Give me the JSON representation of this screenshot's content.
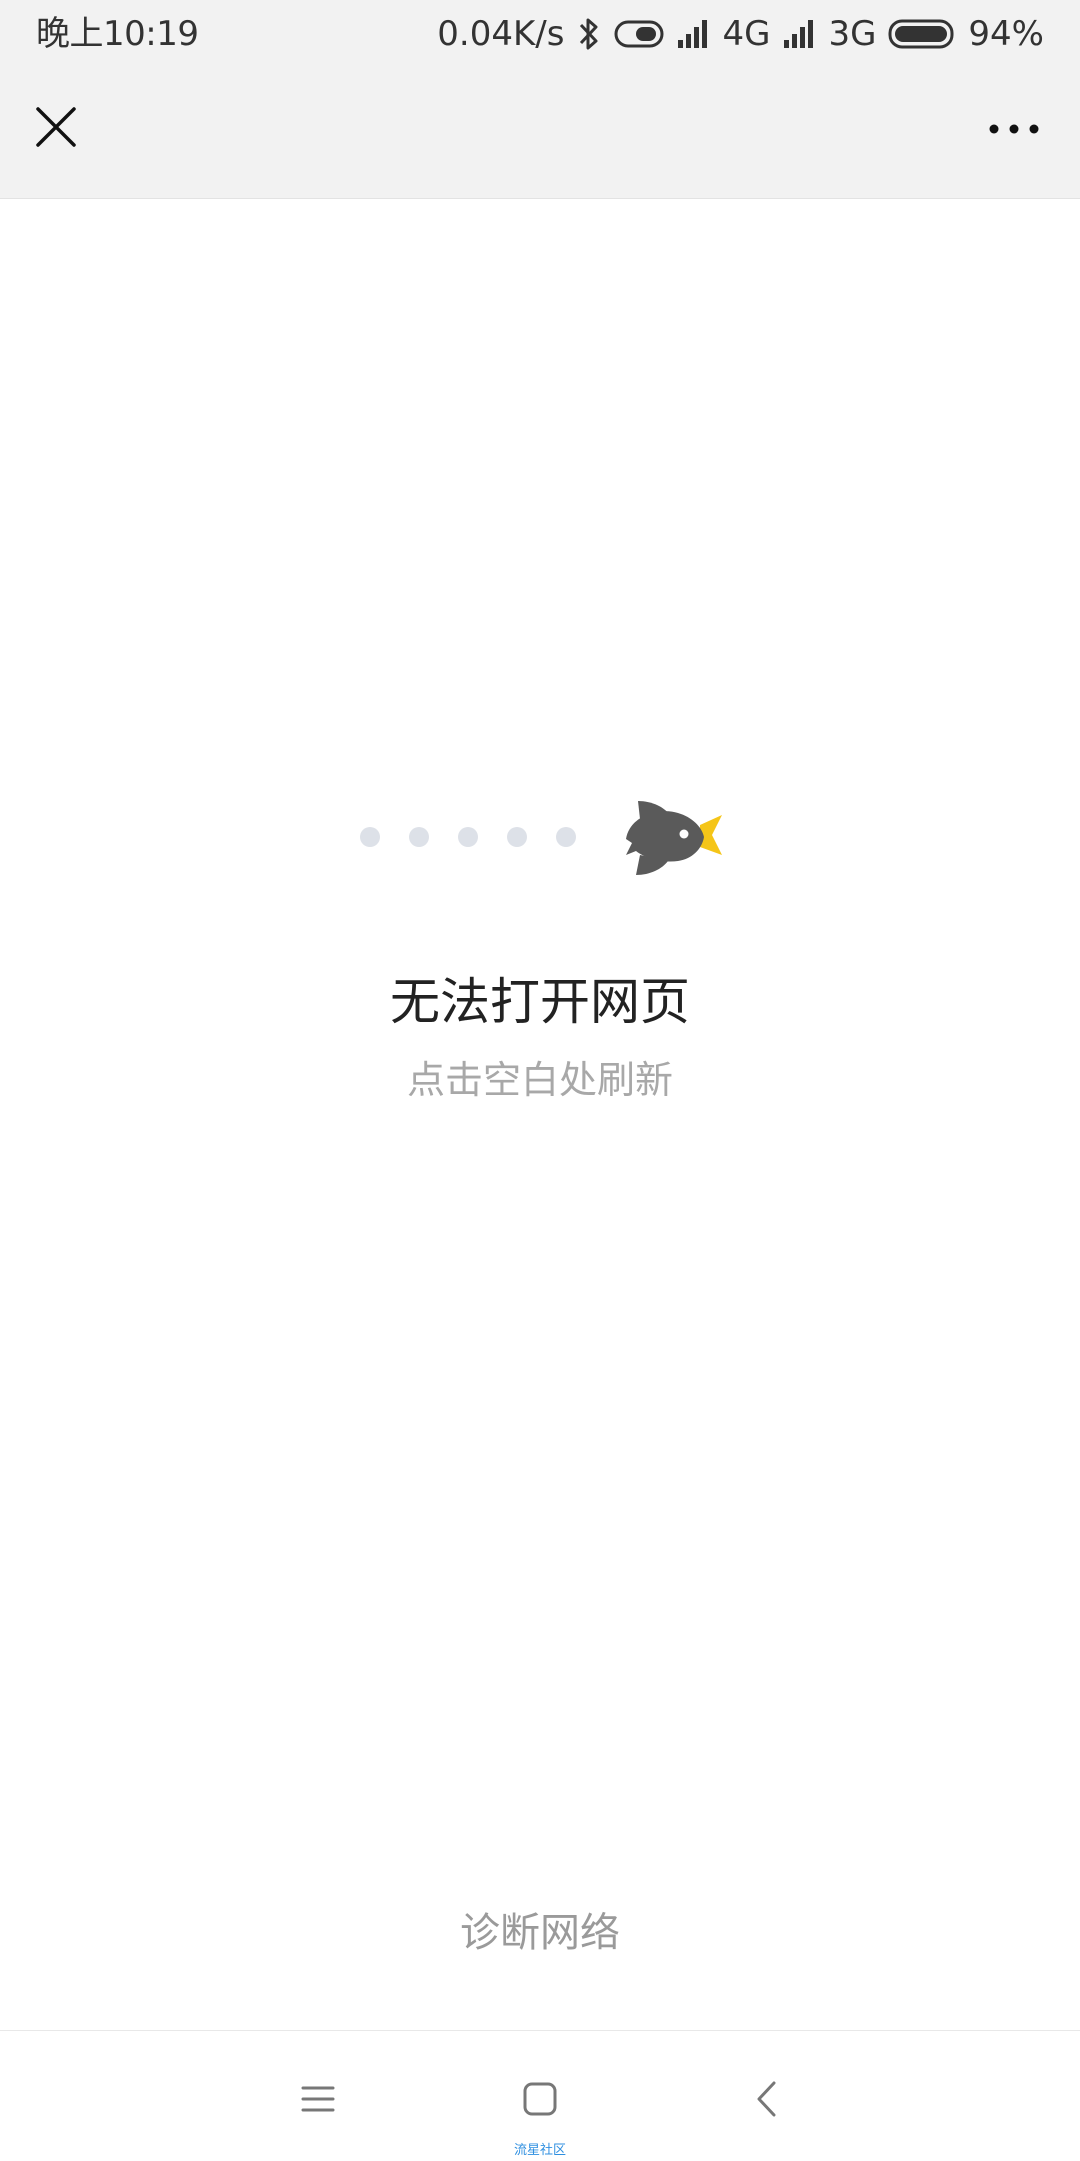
{
  "status_bar": {
    "time": "晚上10:19",
    "net_speed": "0.04K/s",
    "network_1": "4G",
    "network_2": "3G",
    "battery": "94%",
    "icons": [
      "bluetooth-icon",
      "toggle-icon",
      "signal-icon",
      "signal-icon",
      "battery-icon"
    ]
  },
  "nav": {
    "close_icon": "close-icon",
    "more_icon": "more-icon"
  },
  "error": {
    "title": "无法打开网页",
    "hint": "点击空白处刷新",
    "illustration": "bird-loading-illustration"
  },
  "footer": {
    "diagnose_label": "诊断网络"
  },
  "system_nav": {
    "icons": [
      "menu-icon",
      "home-icon",
      "back-icon"
    ],
    "watermark": "流星社区"
  },
  "colors": {
    "bar_bg": "#f2f2f2",
    "dot": "#dde1e8",
    "bird": "#5a5a5a",
    "beak": "#f5c518",
    "hint_text": "#a8a8a8"
  }
}
